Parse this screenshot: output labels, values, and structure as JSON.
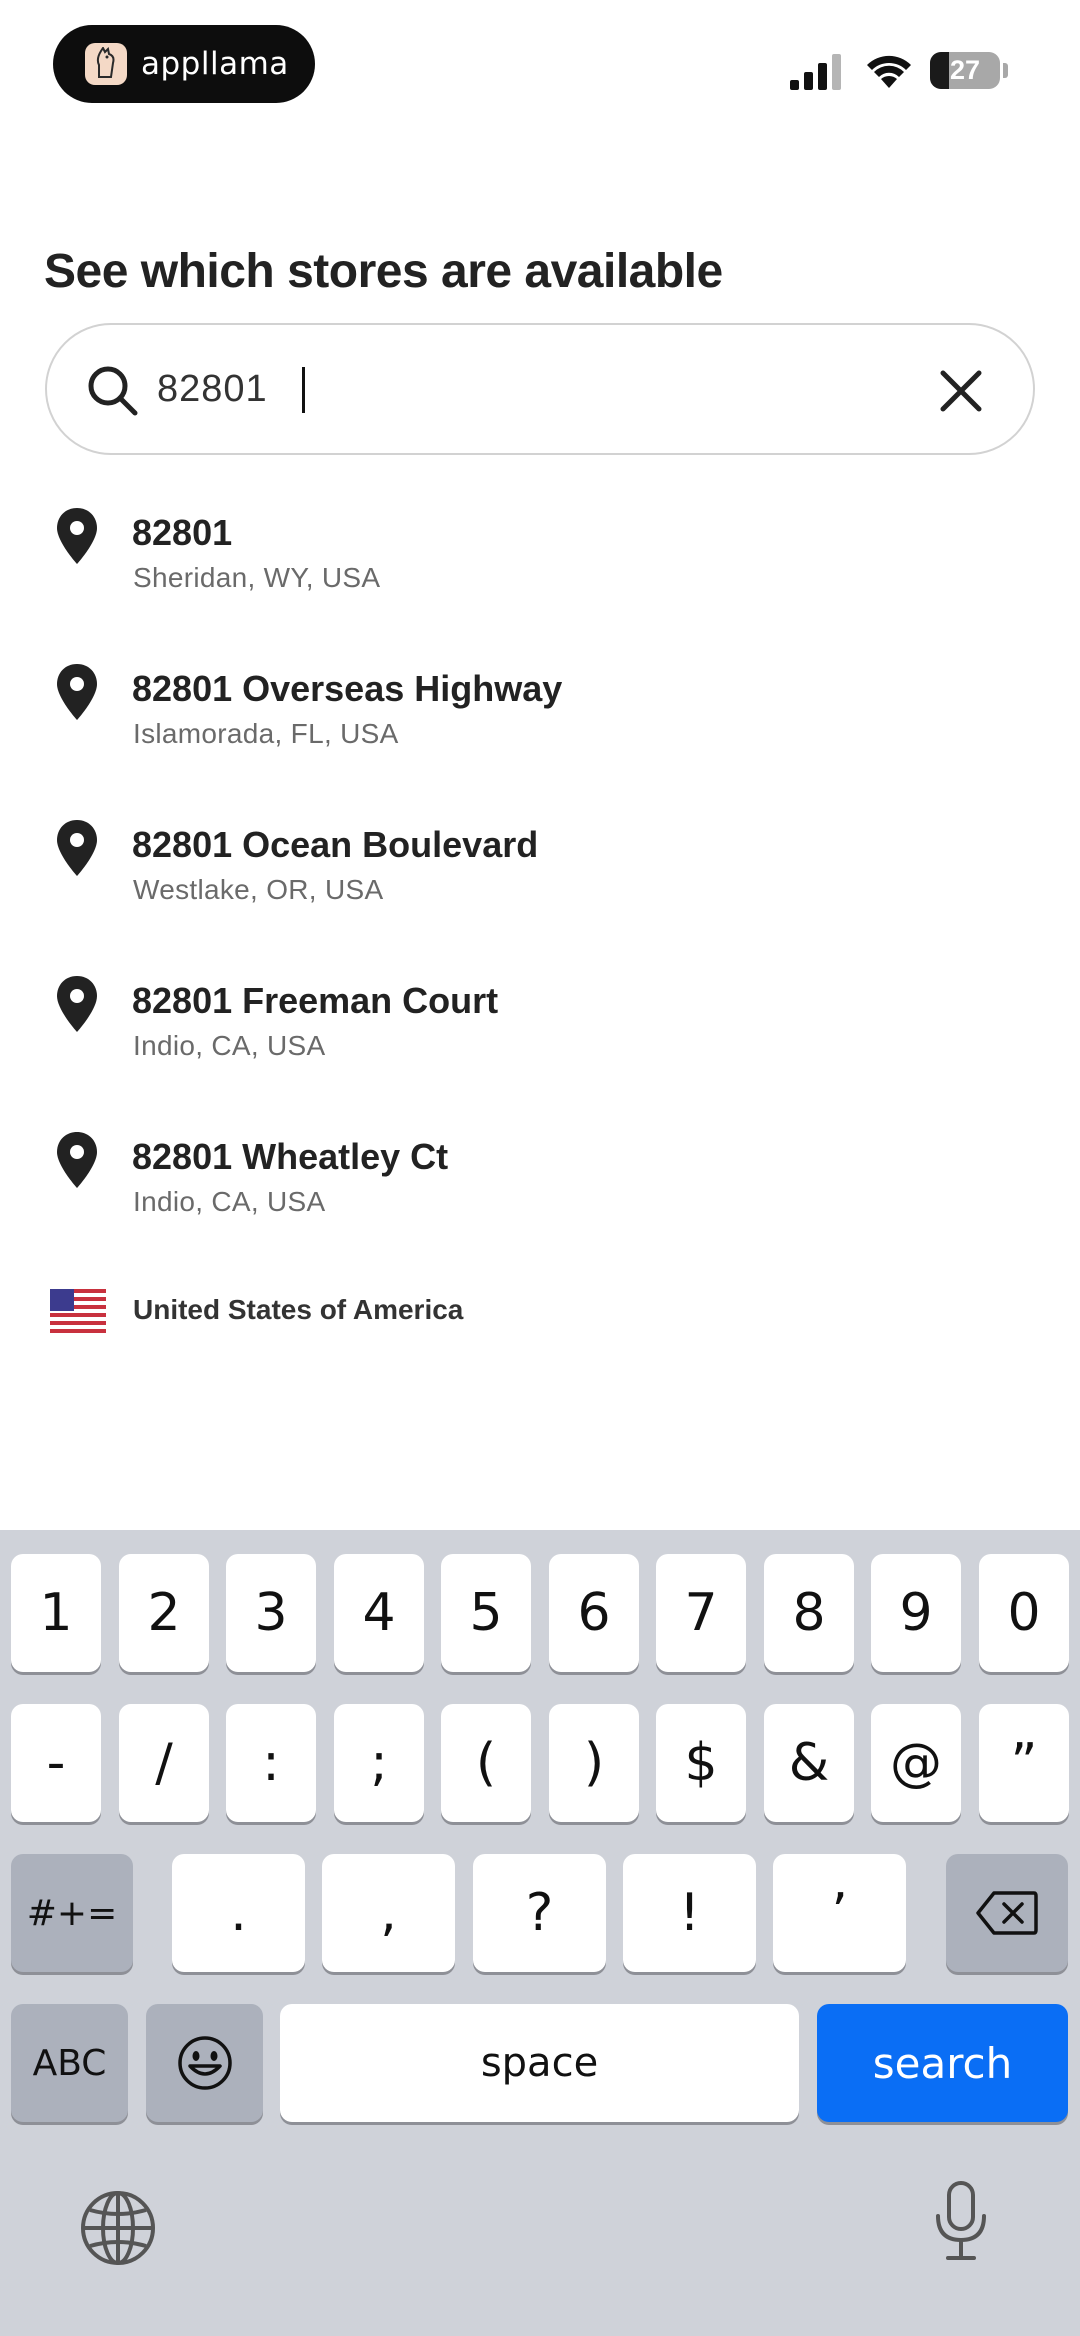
{
  "status_bar": {
    "brand": "appllama",
    "battery": "27",
    "battery_level": 0.27
  },
  "page": {
    "title": "See which stores are available"
  },
  "search": {
    "value": "82801",
    "clear_icon": "close-icon",
    "search_icon": "magnifier-icon"
  },
  "results": [
    {
      "title": "82801",
      "subtitle": "Sheridan, WY, USA"
    },
    {
      "title": "82801 Overseas Highway",
      "subtitle": "Islamorada, FL, USA"
    },
    {
      "title": "82801 Ocean Boulevard",
      "subtitle": "Westlake, OR, USA"
    },
    {
      "title": "82801 Freeman Court",
      "subtitle": "Indio, CA, USA"
    },
    {
      "title": "82801 Wheatley Ct",
      "subtitle": "Indio, CA, USA"
    }
  ],
  "country": {
    "label": "United States of America",
    "flag_icon": "us-flag-icon"
  },
  "keyboard": {
    "row1": [
      "1",
      "2",
      "3",
      "4",
      "5",
      "6",
      "7",
      "8",
      "9",
      "0"
    ],
    "row2": [
      "-",
      "/",
      ":",
      ";",
      "(",
      ")",
      "$",
      "&",
      "@",
      "”"
    ],
    "row3": {
      "mode": "#+=",
      "keys": [
        ".",
        ",",
        "?",
        "!",
        "’"
      ],
      "delete_icon": "backspace-icon"
    },
    "row4": {
      "abc": "ABC",
      "emoji_icon": "emoji-icon",
      "space": "space",
      "action": "search"
    },
    "globe_icon": "globe-icon",
    "mic_icon": "microphone-icon",
    "colors": {
      "background": "#cfd2d9",
      "key": "#ffffff",
      "dark_key": "#acb1bc",
      "action_key": "#0a6ef5"
    }
  }
}
